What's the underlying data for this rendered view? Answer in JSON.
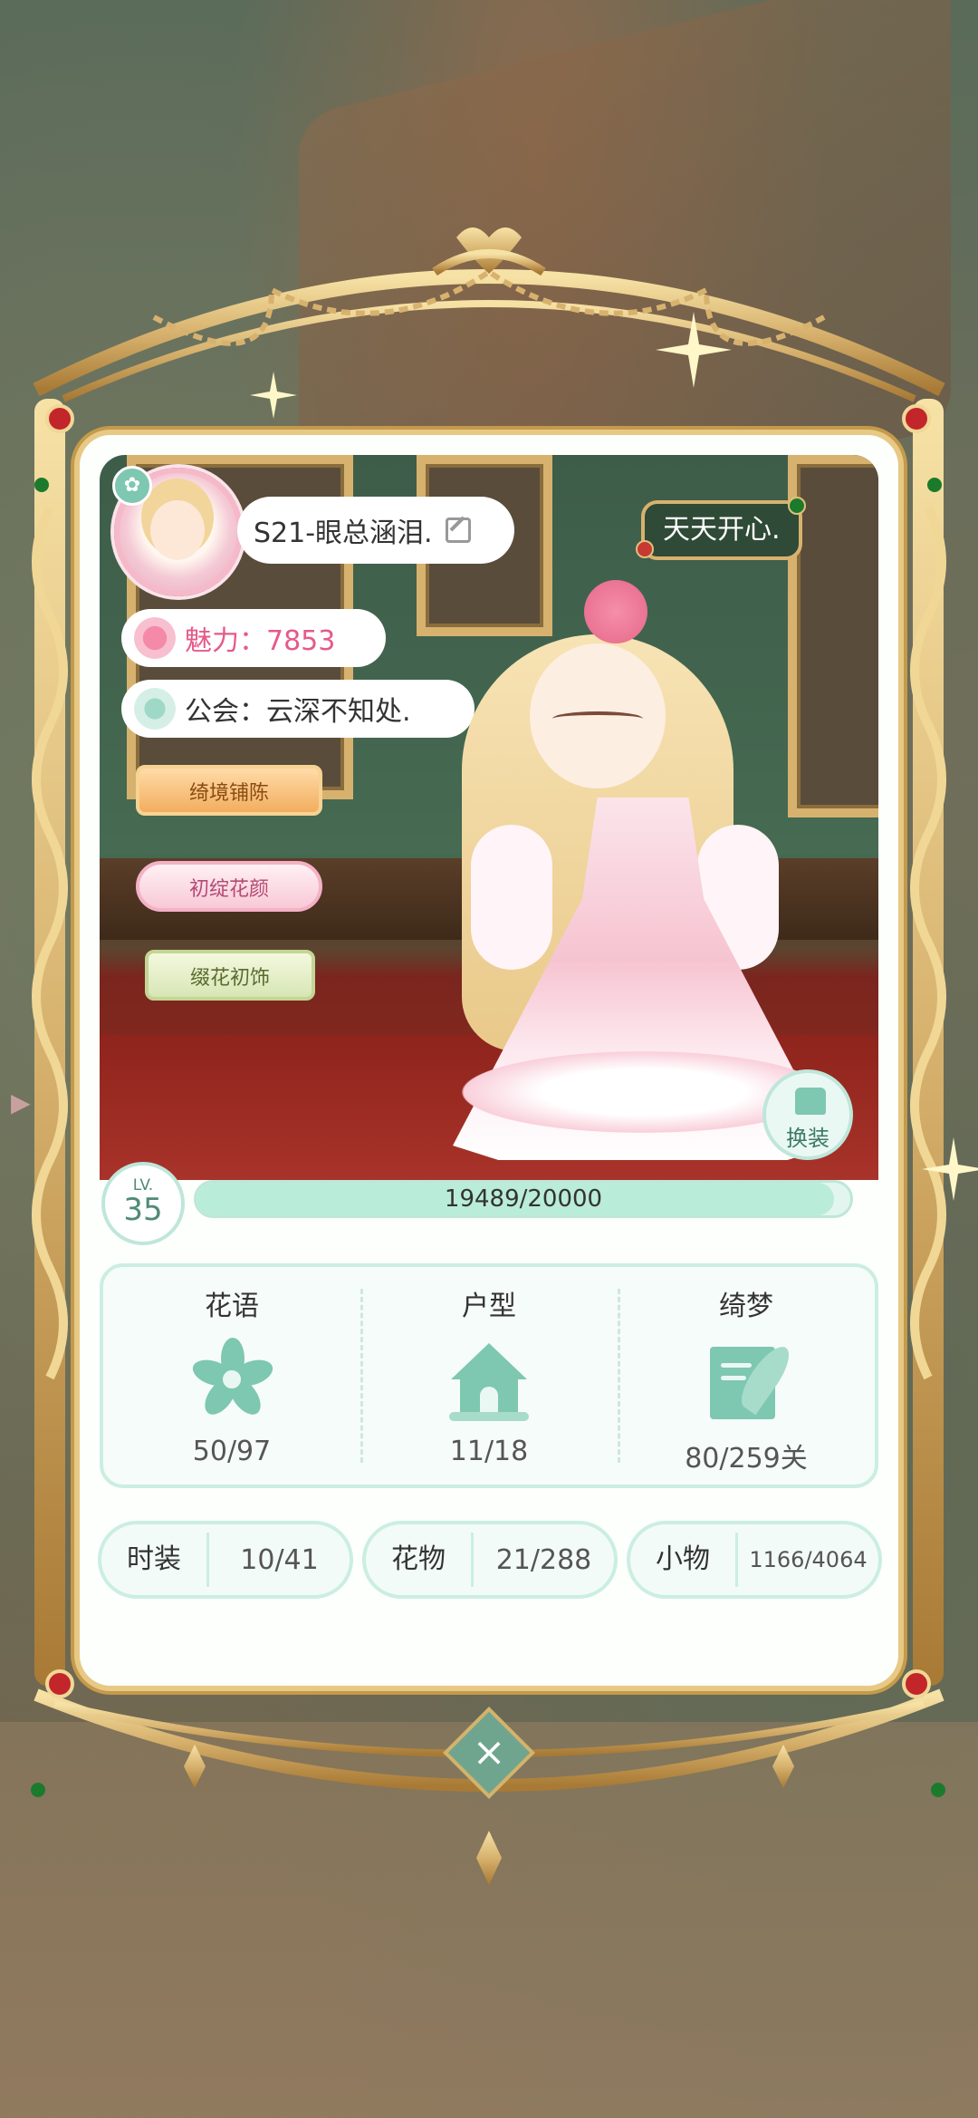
{
  "player": {
    "name": "S21-眼总涵泪.",
    "mood": "天天开心.",
    "charm_label": "魅力：7853",
    "guild_label": "公会：云深不知处."
  },
  "tags": [
    "绮境铺陈",
    "初绽花颜",
    "缀花初饰"
  ],
  "change_outfit_label": "换装",
  "level": {
    "prefix": "LV.",
    "value": "35",
    "xp_text": "19489/20000",
    "xp_fraction": 0.9745
  },
  "stats": [
    {
      "label": "花语",
      "icon": "flower-icon",
      "value": "50/97"
    },
    {
      "label": "户型",
      "icon": "house-icon",
      "value": "11/18"
    },
    {
      "label": "绮梦",
      "icon": "letter-quill-icon",
      "value": "80/259关"
    }
  ],
  "collections": [
    {
      "label": "时装",
      "value": "10/41"
    },
    {
      "label": "花物",
      "value": "21/288"
    },
    {
      "label": "小物",
      "value": "1166/4064"
    }
  ],
  "colors": {
    "accent": "#7ec7b0",
    "gold_frame": "#d7b26e",
    "charm_pink": "#e55a88"
  }
}
